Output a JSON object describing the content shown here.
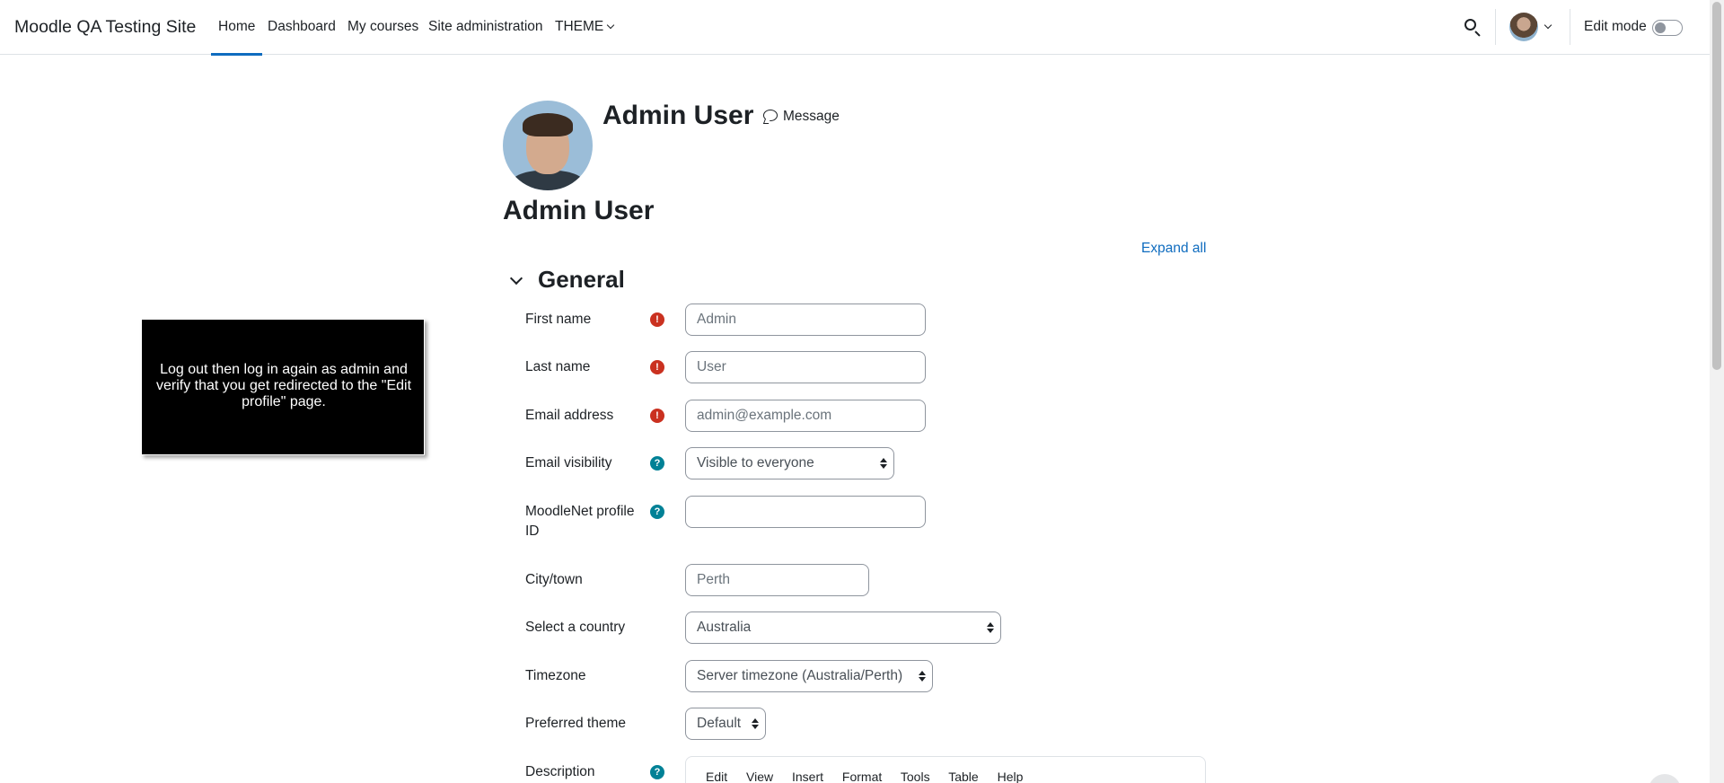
{
  "navbar": {
    "brand": "Moodle QA Testing Site",
    "items": [
      {
        "label": "Home",
        "active": true
      },
      {
        "label": "Dashboard"
      },
      {
        "label": "My courses"
      },
      {
        "label": "Site administration"
      },
      {
        "label": "THEME"
      }
    ],
    "edit_mode_label": "Edit mode",
    "edit_mode_on": false
  },
  "header": {
    "name": "Admin User",
    "message_label": "Message"
  },
  "page_title": "Admin User",
  "expand_all": "Expand all",
  "section": {
    "title": "General"
  },
  "form": {
    "first_name": {
      "label": "First name",
      "value": "Admin"
    },
    "last_name": {
      "label": "Last name",
      "value": "User"
    },
    "email": {
      "label": "Email address",
      "value": "admin@example.com"
    },
    "email_visibility": {
      "label": "Email visibility",
      "value": "Visible to everyone"
    },
    "moodlenet": {
      "label_line1": "MoodleNet profile",
      "label_line2": "ID",
      "value": ""
    },
    "city": {
      "label": "City/town",
      "value": "Perth"
    },
    "country": {
      "label": "Select a country",
      "value": "Australia"
    },
    "timezone": {
      "label": "Timezone",
      "value": "Server timezone (Australia/Perth)"
    },
    "theme": {
      "label": "Preferred theme",
      "value": "Default"
    },
    "description": {
      "label": "Description"
    }
  },
  "editor_menu": [
    "Edit",
    "View",
    "Insert",
    "Format",
    "Tools",
    "Table",
    "Help"
  ],
  "instruction": "Log out then log in again as admin and verify that you get redirected to the \"Edit profile\" page.",
  "icons": {
    "required": "!",
    "help": "?"
  },
  "colors": {
    "accent": "#0f6cbf",
    "required": "#ca3120",
    "help": "#008196"
  }
}
